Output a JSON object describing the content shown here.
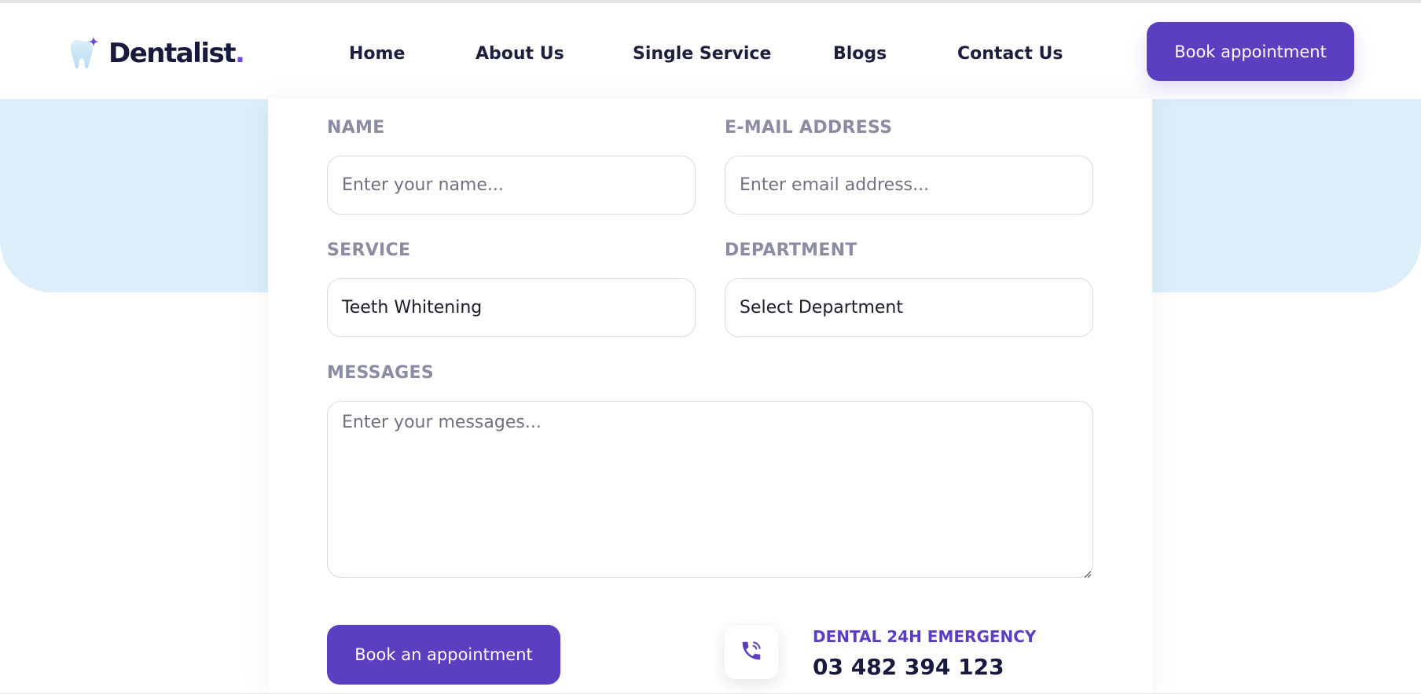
{
  "header": {
    "logo_text": "Dentalist",
    "logo_dot": ".",
    "nav": [
      {
        "label": "Home"
      },
      {
        "label": "About Us"
      },
      {
        "label": "Single Service"
      },
      {
        "label": "Blogs"
      },
      {
        "label": "Contact Us"
      }
    ],
    "cta_label": "Book appointment"
  },
  "form": {
    "name_label": "NAME",
    "name_placeholder": "Enter your name...",
    "email_label": "E-MAIL ADDRESS",
    "email_placeholder": "Enter email address...",
    "service_label": "SERVICE",
    "service_value": "Teeth Whitening",
    "department_label": "DEPARTMENT",
    "department_value": "Select Department",
    "messages_label": "MESSAGES",
    "messages_placeholder": "Enter your messages...",
    "submit_label": "Book an appointment"
  },
  "emergency": {
    "label": "DENTAL 24H EMERGENCY",
    "phone": "03 482 394 123",
    "icon": "phone-icon"
  },
  "colors": {
    "brand": "#5a3fc0",
    "hero_bg": "#dbeef9",
    "heading": "#171a3d",
    "label": "#8b8ca3"
  }
}
